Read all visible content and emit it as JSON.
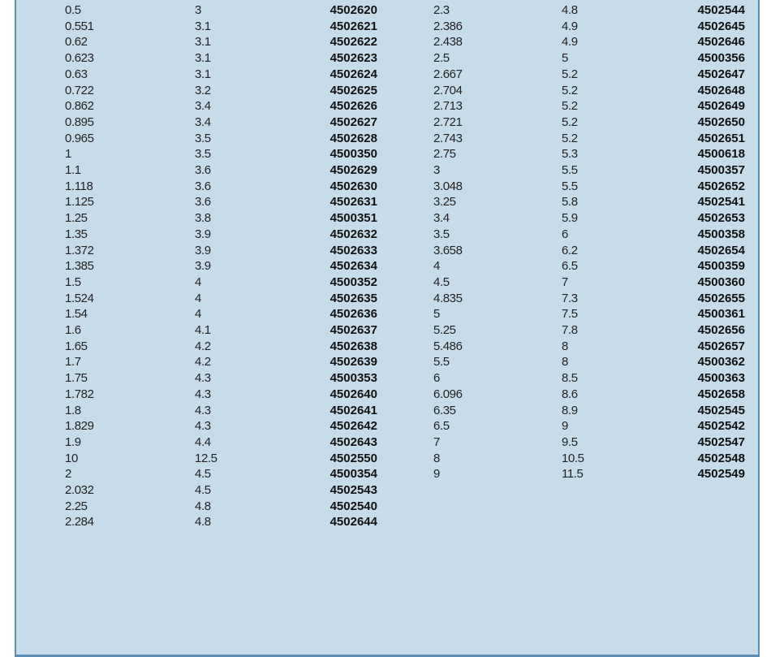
{
  "left_rows": [
    [
      "0.5",
      "3",
      "4502620"
    ],
    [
      "0.551",
      "3.1",
      "4502621"
    ],
    [
      "0.62",
      "3.1",
      "4502622"
    ],
    [
      "0.623",
      "3.1",
      "4502623"
    ],
    [
      "0.63",
      "3.1",
      "4502624"
    ],
    [
      "0.722",
      "3.2",
      "4502625"
    ],
    [
      "0.862",
      "3.4",
      "4502626"
    ],
    [
      "0.895",
      "3.4",
      "4502627"
    ],
    [
      "0.965",
      "3.5",
      "4502628"
    ],
    [
      "1",
      "3.5",
      "4500350"
    ],
    [
      "1.1",
      "3.6",
      "4502629"
    ],
    [
      "1.118",
      "3.6",
      "4502630"
    ],
    [
      "1.125",
      "3.6",
      "4502631"
    ],
    [
      "1.25",
      "3.8",
      "4500351"
    ],
    [
      "1.35",
      "3.9",
      "4502632"
    ],
    [
      "1.372",
      "3.9",
      "4502633"
    ],
    [
      "1.385",
      "3.9",
      "4502634"
    ],
    [
      "1.5",
      "4",
      "4500352"
    ],
    [
      "1.524",
      "4",
      "4502635"
    ],
    [
      "1.54",
      "4",
      "4502636"
    ],
    [
      "1.6",
      "4.1",
      "4502637"
    ],
    [
      "1.65",
      "4.2",
      "4502638"
    ],
    [
      "1.7",
      "4.2",
      "4502639"
    ],
    [
      "1.75",
      "4.3",
      "4500353"
    ],
    [
      "1.782",
      "4.3",
      "4502640"
    ],
    [
      "1.8",
      "4.3",
      "4502641"
    ],
    [
      "1.829",
      "4.3",
      "4502642"
    ],
    [
      "1.9",
      "4.4",
      "4502643"
    ],
    [
      "10",
      "12.5",
      "4502550"
    ],
    [
      "2",
      "4.5",
      "4500354"
    ],
    [
      "2.032",
      "4.5",
      "4502543"
    ],
    [
      "2.25",
      "4.8",
      "4502540"
    ],
    [
      "2.284",
      "4.8",
      "4502644"
    ]
  ],
  "right_rows": [
    [
      "2.3",
      "4.8",
      "4502544"
    ],
    [
      "2.386",
      "4.9",
      "4502645"
    ],
    [
      "2.438",
      "4.9",
      "4502646"
    ],
    [
      "2.5",
      "5",
      "4500356"
    ],
    [
      "2.667",
      "5.2",
      "4502647"
    ],
    [
      "2.704",
      "5.2",
      "4502648"
    ],
    [
      "2.713",
      "5.2",
      "4502649"
    ],
    [
      "2.721",
      "5.2",
      "4502650"
    ],
    [
      "2.743",
      "5.2",
      "4502651"
    ],
    [
      "2.75",
      "5.3",
      "4500618"
    ],
    [
      "3",
      "5.5",
      "4500357"
    ],
    [
      "3.048",
      "5.5",
      "4502652"
    ],
    [
      "3.25",
      "5.8",
      "4502541"
    ],
    [
      "3.4",
      "5.9",
      "4502653"
    ],
    [
      "3.5",
      "6",
      "4500358"
    ],
    [
      "3.658",
      "6.2",
      "4502654"
    ],
    [
      "4",
      "6.5",
      "4500359"
    ],
    [
      "4.5",
      "7",
      "4500360"
    ],
    [
      "4.835",
      "7.3",
      "4502655"
    ],
    [
      "5",
      "7.5",
      "4500361"
    ],
    [
      "5.25",
      "7.8",
      "4502656"
    ],
    [
      "5.486",
      "8",
      "4502657"
    ],
    [
      "5.5",
      "8",
      "4500362"
    ],
    [
      "6",
      "8.5",
      "4500363"
    ],
    [
      "6.096",
      "8.6",
      "4502658"
    ],
    [
      "6.35",
      "8.9",
      "4502545"
    ],
    [
      "6.5",
      "9",
      "4502542"
    ],
    [
      "7",
      "9.5",
      "4502547"
    ],
    [
      "8",
      "10.5",
      "4502548"
    ],
    [
      "9",
      "11.5",
      "4502549"
    ]
  ]
}
